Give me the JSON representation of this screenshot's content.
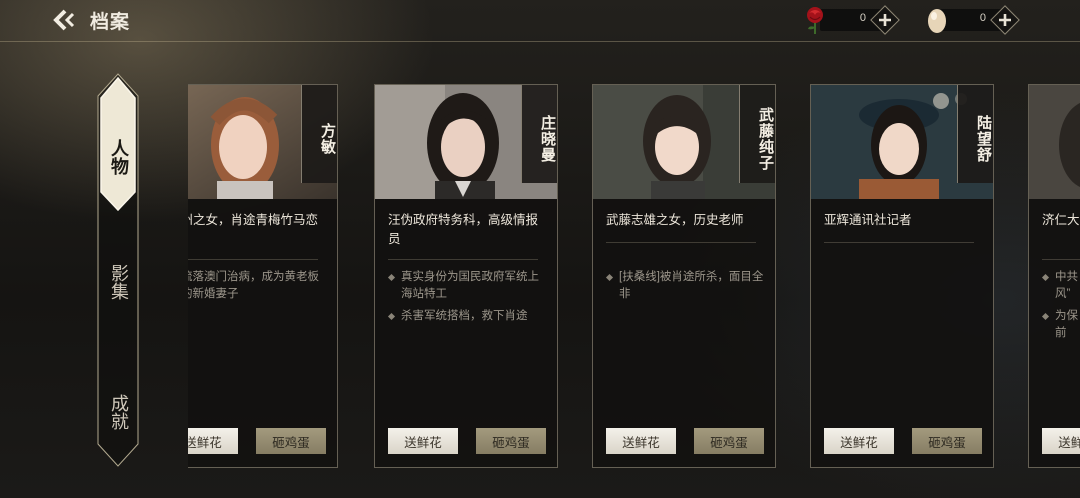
{
  "header": {
    "title": "档案",
    "resources": [
      {
        "name": "rose",
        "icon": "rose-icon",
        "count": "0"
      },
      {
        "name": "egg",
        "icon": "egg-icon",
        "count": "0"
      }
    ]
  },
  "side_tabs": [
    {
      "label": "人物",
      "selected": true
    },
    {
      "label": "影集",
      "selected": false
    },
    {
      "label": "成就",
      "selected": false
    }
  ],
  "cards": [
    {
      "name": "方敏",
      "description": "杭州之女，肖途青梅竹马恋人",
      "notes": [
        "流落澳门治病，成为黄老板的新婚妻子"
      ],
      "flower_label": "送鲜花",
      "egg_label": "砸鸡蛋"
    },
    {
      "name": "庄晓曼",
      "description": "汪伪政府特务科，高级情报员",
      "notes": [
        "真实身份为国民政府军统上海站特工",
        "杀害军统搭档，救下肖途"
      ],
      "flower_label": "送鲜花",
      "egg_label": "砸鸡蛋"
    },
    {
      "name": "武藤纯子",
      "description": "武藤志雄之女，历史老师",
      "notes": [
        "[扶桑线]被肖途所杀，面目全非"
      ],
      "flower_label": "送鲜花",
      "egg_label": "砸鸡蛋"
    },
    {
      "name": "陆望舒",
      "description": "亚辉通讯社记者",
      "notes": [],
      "flower_label": "送鲜花",
      "egg_label": "砸鸡蛋"
    },
    {
      "name": "",
      "description": "济仁大",
      "notes": [
        "中共风”",
        "为保前"
      ],
      "flower_label": "送鲜花",
      "egg_label": ""
    }
  ],
  "colors": {
    "accent_gold": "#c9b98c",
    "rose_red": "#b0141a",
    "flower_button": "#e9e5dc",
    "egg_button": "#958c70"
  }
}
